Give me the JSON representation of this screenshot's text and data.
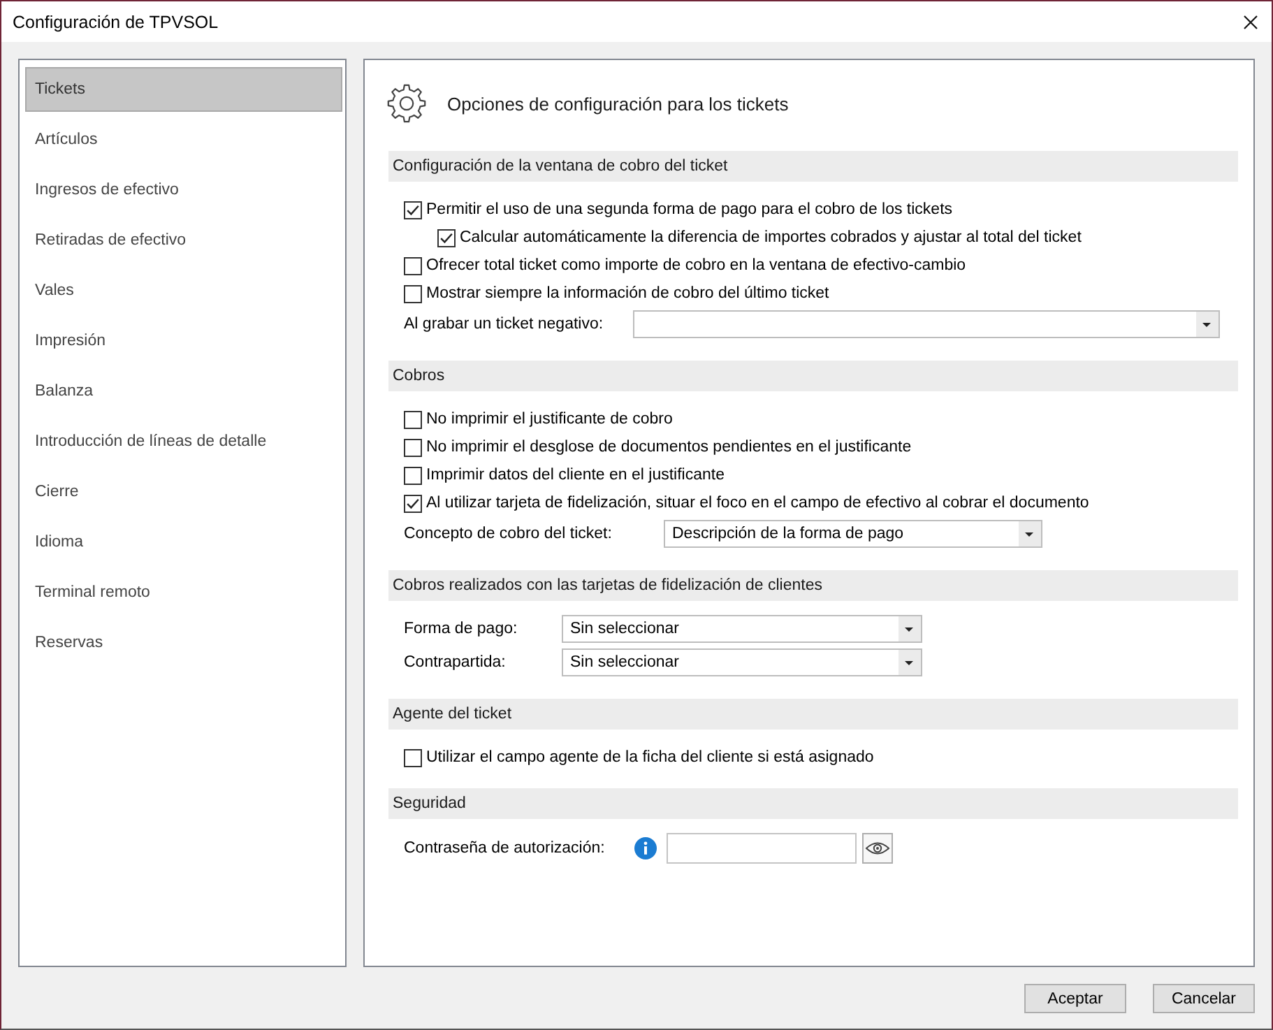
{
  "window": {
    "title": "Configuración de TPVSOL"
  },
  "sidebar": {
    "items": [
      {
        "label": "Tickets",
        "selected": true
      },
      {
        "label": "Artículos",
        "selected": false
      },
      {
        "label": "Ingresos de efectivo",
        "selected": false
      },
      {
        "label": "Retiradas de efectivo",
        "selected": false
      },
      {
        "label": "Vales",
        "selected": false
      },
      {
        "label": "Impresión",
        "selected": false
      },
      {
        "label": "Balanza",
        "selected": false
      },
      {
        "label": "Introducción de líneas de detalle",
        "selected": false
      },
      {
        "label": "Cierre",
        "selected": false
      },
      {
        "label": "Idioma",
        "selected": false
      },
      {
        "label": "Terminal remoto",
        "selected": false
      },
      {
        "label": "Reservas",
        "selected": false
      }
    ]
  },
  "panel": {
    "title": "Opciones de configuración para los tickets",
    "sections": [
      {
        "title": "Configuración de la ventana de cobro del ticket",
        "controls": [
          {
            "kind": "checkbox",
            "label": "Permitir el uso de una segunda forma de pago para el cobro de los tickets",
            "checked": true,
            "children": [
              {
                "kind": "checkbox",
                "label": "Calcular automáticamente la diferencia de importes cobrados y ajustar al total del ticket",
                "checked": true
              }
            ]
          },
          {
            "kind": "checkbox",
            "label": "Ofrecer total ticket como importe de cobro en la ventana de efectivo-cambio",
            "checked": false
          },
          {
            "kind": "checkbox",
            "label": "Mostrar siempre la información de cobro del último ticket",
            "checked": false
          },
          {
            "kind": "dropdown",
            "label": "Al grabar un ticket negativo:"
          }
        ]
      },
      {
        "title": "Cobros",
        "controls": [
          {
            "kind": "checkbox",
            "label": "No imprimir el justificante de cobro",
            "checked": false
          },
          {
            "kind": "checkbox",
            "label": "No imprimir el desglose de documentos pendientes en el justificante",
            "checked": false
          },
          {
            "kind": "checkbox",
            "label": "Imprimir datos del cliente en el justificante",
            "checked": false
          },
          {
            "kind": "checkbox",
            "label": "Al utilizar tarjeta de fidelización, situar el foco en el campo de efectivo al cobrar el documento",
            "checked": true
          },
          {
            "kind": "dropdown",
            "label": "Concepto de cobro del ticket:",
            "value": "Descripción de la forma de pago"
          }
        ]
      },
      {
        "title": "Cobros realizados con las tarjetas de fidelización de clientes",
        "controls": [
          {
            "kind": "dropdown",
            "label": "Forma de pago:",
            "value": "Sin seleccionar"
          },
          {
            "kind": "dropdown",
            "label": "Contrapartida:",
            "value": "Sin seleccionar"
          }
        ]
      },
      {
        "title": "Agente del ticket",
        "controls": [
          {
            "kind": "checkbox",
            "label": "Utilizar el campo agente de la ficha del cliente si está asignado",
            "checked": false
          }
        ]
      },
      {
        "title": "Seguridad",
        "controls": [
          {
            "kind": "password",
            "label": "Contraseña de autorización:"
          }
        ]
      }
    ]
  },
  "buttons": [
    "Aceptar",
    "Cancelar"
  ]
}
